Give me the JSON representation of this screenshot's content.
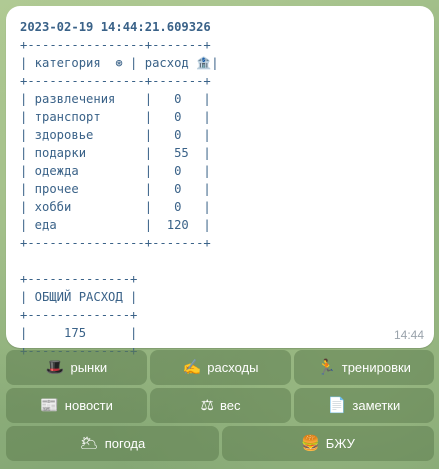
{
  "message": {
    "timestamp_line": "2023-02-19 14:44:21.609326",
    "table": "+----------------+-------+\n| категория  ⊛ | расход 🏦|\n+----------------+-------+\n| развлечения    |   0   |\n| транспорт      |   0   |\n| здоровье       |   0   |\n| подарки        |   55  |\n| одежда         |   0   |\n| прочее         |   0   |\n| хобби          |   0   |\n| еда            |  120  |\n+----------------+-------+\n\n+--------------+\n| ОБЩИЙ РАСХОД |\n+--------------+\n|     175      |\n+--------------+",
    "time": "14:44"
  },
  "keyboard": {
    "row1": [
      {
        "icon": "🎩",
        "label": "рынки"
      },
      {
        "icon": "✍",
        "label": "расходы"
      },
      {
        "icon": "🏃",
        "label": "тренировки"
      }
    ],
    "row2": [
      {
        "icon": "📰",
        "label": "новости"
      },
      {
        "icon": "⚖",
        "label": "вес"
      },
      {
        "icon": "📄",
        "label": "заметки"
      }
    ],
    "row3": [
      {
        "icon": "🌥",
        "label": "погода"
      },
      {
        "icon": "🍔",
        "label": "БЖУ"
      }
    ]
  }
}
